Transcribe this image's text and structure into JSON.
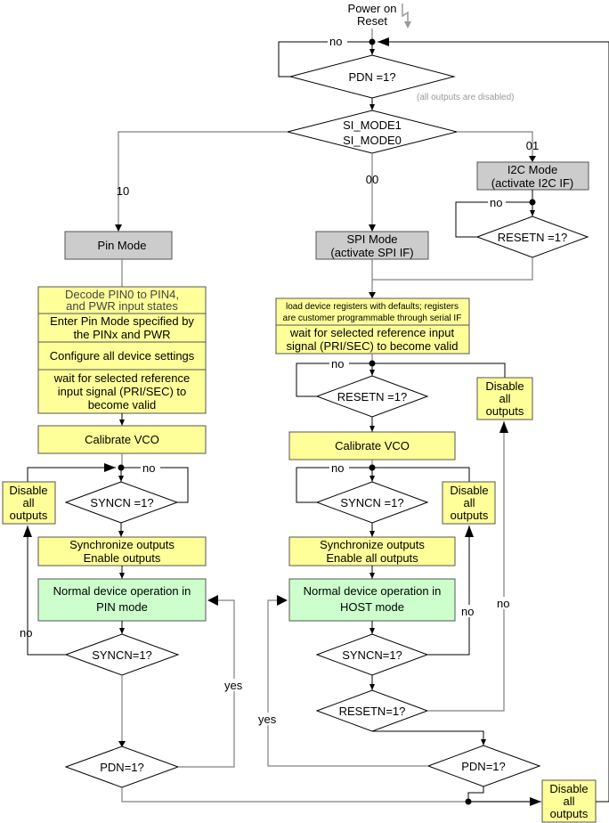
{
  "start": {
    "line1": "Power on",
    "line2": "Reset"
  },
  "note_disabled": "(all outputs are disabled)",
  "decisions": {
    "pdn_top": "PDN =1?",
    "mode_line1": "SI_MODE1",
    "mode_line2": "SI_MODE0",
    "i2c_resetn": "RESETN =1?",
    "spi_resetn": "RESETN =1?",
    "pin_syncn1": "SYNCN =1?",
    "pin_syncn2": "SYNCN=1?",
    "pin_pdn": "PDN=1?",
    "host_syncn1": "SYNCN =1?",
    "host_syncn2": "SYNCN=1?",
    "host_resetn": "RESETN=1?",
    "host_pdn": "PDN=1?"
  },
  "branch_labels": {
    "pin": "10",
    "spi": "00",
    "i2c": "01"
  },
  "modes": {
    "pin": "Pin Mode",
    "spi_line1": "SPI Mode",
    "spi_line2": "(activate SPI IF)",
    "i2c_line1": "I2C Mode",
    "i2c_line2": "(activate I2C IF)"
  },
  "pin_steps": {
    "decode_l1": "Decode PIN0 to PIN4,",
    "decode_l2": "and PWR input states",
    "enter_l1": "Enter Pin Mode specified by",
    "enter_l2": "the PINx and PWR",
    "configure": "Configure all device settings",
    "wait_l1": "wait for selected reference",
    "wait_l2": "input signal (PRI/SEC) to",
    "wait_l3": "become valid",
    "calibrate": "Calibrate VCO",
    "sync_l1": "Synchronize outputs",
    "sync_l2": "Enable outputs",
    "normal_l1": "Normal device operation in",
    "normal_l2": "PIN mode"
  },
  "host_steps": {
    "load_l1": "load device registers with defaults; registers",
    "load_l2": "are customer programmable through serial IF",
    "wait_l1": "wait for selected reference input",
    "wait_l2": "signal (PRI/SEC) to become valid",
    "calibrate": "Calibrate VCO",
    "sync_l1": "Synchronize outputs",
    "sync_l2": "Enable all outputs",
    "normal_l1": "Normal device operation in",
    "normal_l2": "HOST mode"
  },
  "disable_box": {
    "l1": "Disable",
    "l2": "all",
    "l3": "outputs"
  },
  "edge_labels": {
    "no": "no",
    "yes": "yes"
  },
  "colors": {
    "process": "#ffff99",
    "mode": "#cccccc",
    "normal": "#ccffcc"
  }
}
